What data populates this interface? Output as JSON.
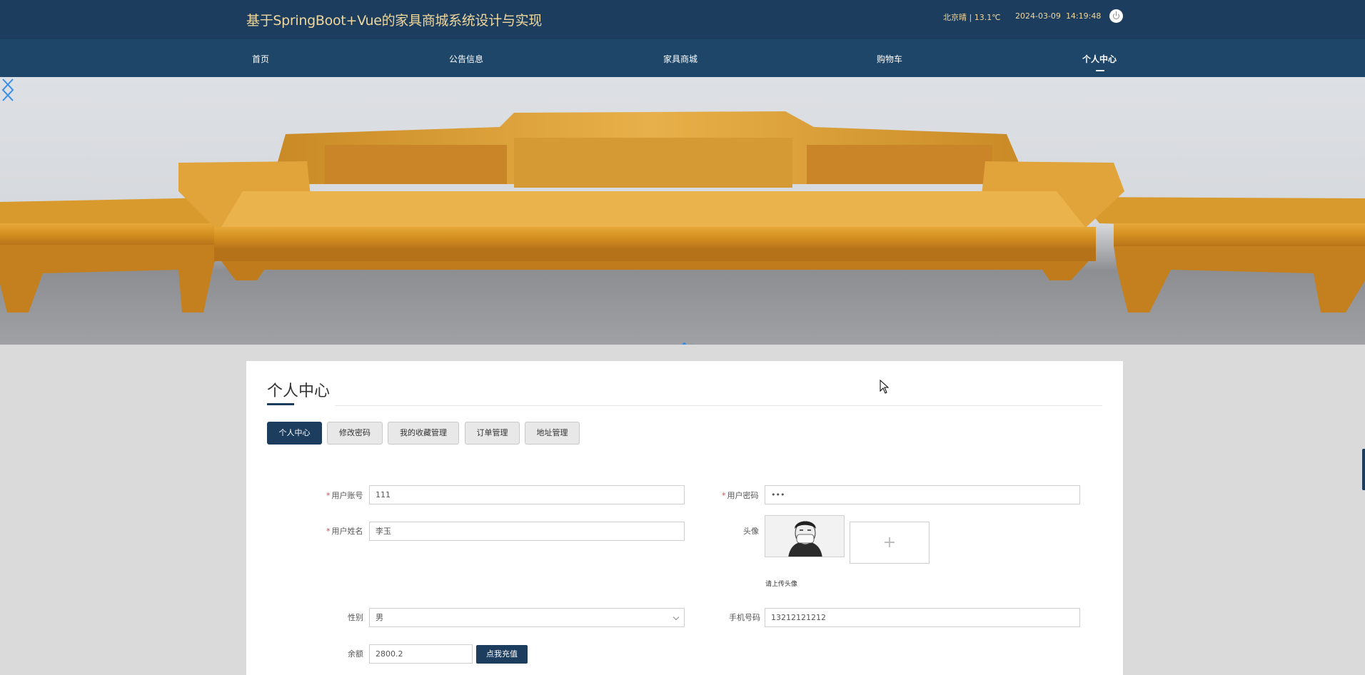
{
  "header": {
    "title": "基于SpringBoot+Vue的家具商城系统设计与实现",
    "weather": "北京晴 | 13.1℃",
    "date": "2024-03-09",
    "time": "14:19:48",
    "logout_icon": "power-icon"
  },
  "nav": {
    "items": [
      {
        "label": "首页"
      },
      {
        "label": "公告信息"
      },
      {
        "label": "家具商城"
      },
      {
        "label": "购物车"
      },
      {
        "label": "个人中心"
      }
    ],
    "active_index": 4
  },
  "banner": {
    "slide_count": 2,
    "active_slide": 0,
    "prev_icon": "chevron-left-icon",
    "next_icon": "chevron-right-icon"
  },
  "page": {
    "title": "个人中心"
  },
  "tabs": [
    {
      "label": "个人中心"
    },
    {
      "label": "修改密码"
    },
    {
      "label": "我的收藏管理"
    },
    {
      "label": "订单管理"
    },
    {
      "label": "地址管理"
    }
  ],
  "form": {
    "account": {
      "label": "用户账号",
      "value": "111",
      "required": "*"
    },
    "password": {
      "label": "用户密码",
      "value": "•••",
      "required": "*"
    },
    "name": {
      "label": "用户姓名",
      "value": "李玉",
      "required": "*"
    },
    "avatar": {
      "label": "头像",
      "hint": "请上传头像",
      "upload_icon": "+"
    },
    "gender": {
      "label": "性别",
      "value": "男"
    },
    "phone": {
      "label": "手机号码",
      "value": "13212121212"
    },
    "balance": {
      "label": "余额",
      "value": "2800.2",
      "button": "点我充值"
    }
  },
  "colors": {
    "header_bg": "#1c3d5e",
    "nav_bg": "#1e4669",
    "title_text": "#f0d79c",
    "accent": "#1c3d5e",
    "required": "#e04545"
  }
}
